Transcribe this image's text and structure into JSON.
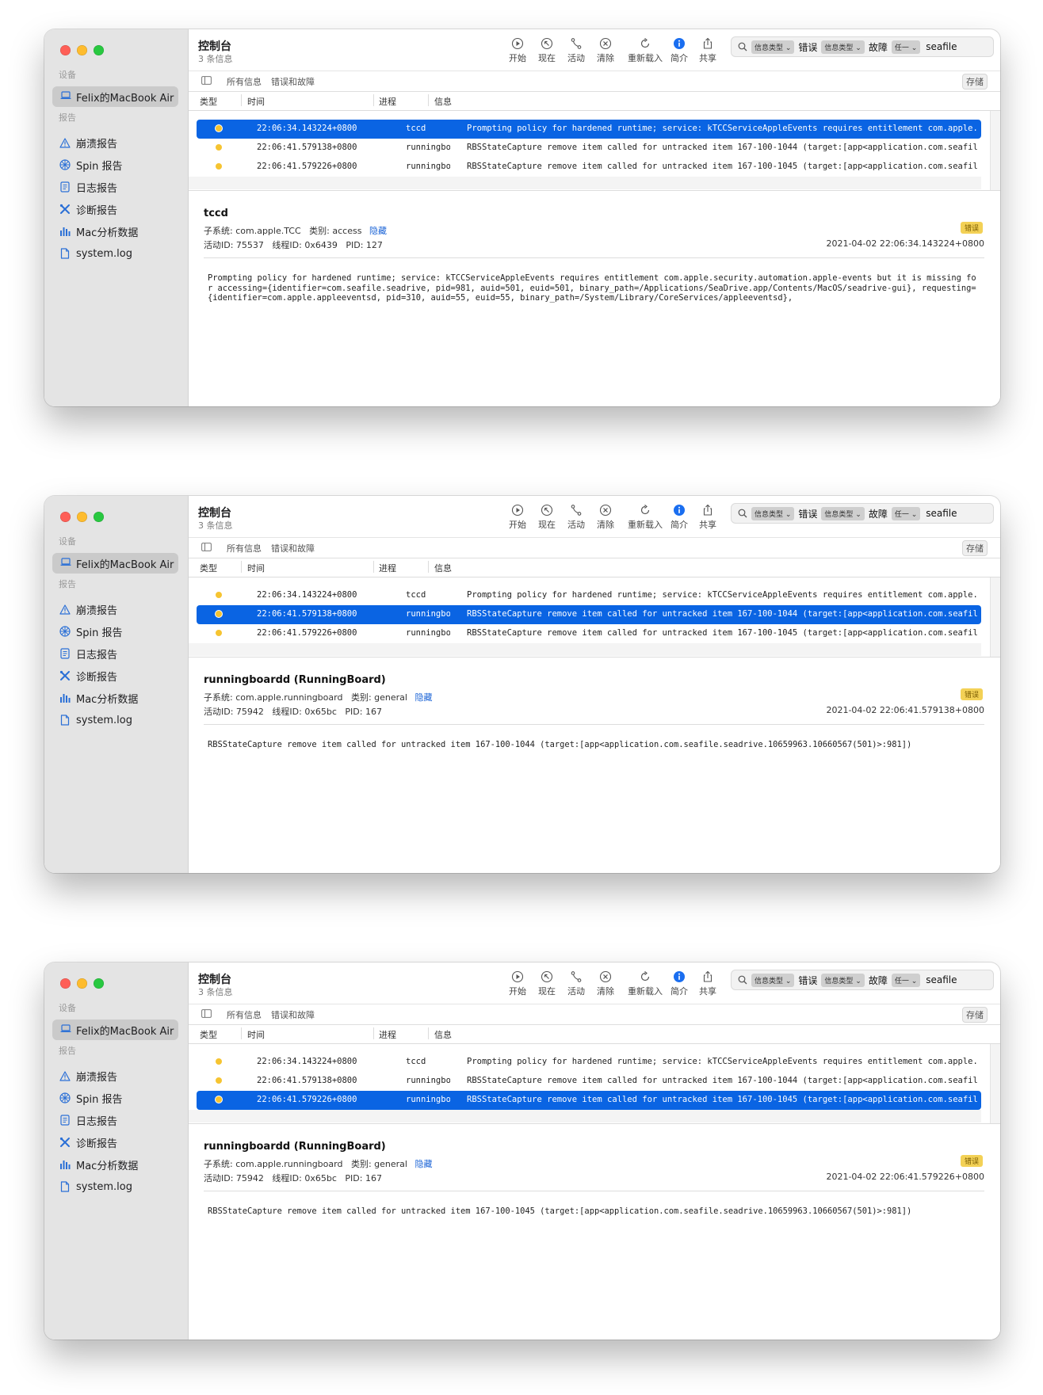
{
  "sidebar": {
    "devices_label": "设备",
    "device_name": "Felix的MacBook Air",
    "reports_label": "报告",
    "items": [
      {
        "label": "崩溃报告",
        "icon": "warning-icon"
      },
      {
        "label": "Spin 报告",
        "icon": "spin-icon"
      },
      {
        "label": "日志报告",
        "icon": "document-icon"
      },
      {
        "label": "诊断报告",
        "icon": "tools-icon"
      },
      {
        "label": "Mac分析数据",
        "icon": "bar-chart-icon"
      },
      {
        "label": "system.log",
        "icon": "file-icon"
      }
    ]
  },
  "toolbar": {
    "title": "控制台",
    "subtitle": "3 条信息",
    "start": "开始",
    "now": "现在",
    "activity": "活动",
    "clear": "清除",
    "reload": "重新载入",
    "info": "简介",
    "share": "共享"
  },
  "search": {
    "token1": "信息类型 ⌄",
    "word1": "错误",
    "token2": "信息类型 ⌄",
    "word2": "故障",
    "token3": "任一 ⌄",
    "value": "seafile"
  },
  "filters": {
    "all": "所有信息",
    "errors": "错误和故障",
    "save": "存储"
  },
  "columns": {
    "type": "类型",
    "time": "时间",
    "process": "进程",
    "message": "信息"
  },
  "rows": [
    {
      "time": "22:06:34.143224+0800",
      "process": "tccd",
      "message": "Prompting policy for hardened runtime; service: kTCCServiceAppleEvents requires entitlement com.apple.security.automation.apple-events"
    },
    {
      "time": "22:06:41.579138+0800",
      "process": "runningboardd",
      "message": "RBSStateCapture remove item called for untracked item 167-100-1044 (target:[app<application.com.seafile.seadrive.10659963.10660567(501)>:981])"
    },
    {
      "time": "22:06:41.579226+0800",
      "process": "runningboardd",
      "message": "RBSStateCapture remove item called for untracked item 167-100-1045 (target:[app<application.com.seafile.seadrive.10659963.10660567(501)>:981])"
    }
  ],
  "labels": {
    "subsystem": "子系统:",
    "category": "类别:",
    "hide": "隐藏",
    "activity_id": "活动ID:",
    "thread_id": "线程ID:",
    "pid": "PID:",
    "badge": "错误"
  },
  "windows": [
    {
      "selected": 0,
      "detail": {
        "title": "tccd",
        "subsystem": "com.apple.TCC",
        "category": "access",
        "activity_id": "75537",
        "thread_id": "0x6439",
        "pid": "127",
        "timestamp": "2021-04-02 22:06:34.143224+0800",
        "message": "Prompting policy for hardened runtime; service: kTCCServiceAppleEvents requires entitlement com.apple.security.automation.apple-events but it is missing for accessing={identifier=com.seafile.seadrive, pid=981, auid=501, euid=501, binary_path=/Applications/SeaDrive.app/Contents/MacOS/seadrive-gui}, requesting={identifier=com.apple.appleeventsd, pid=310, auid=55, euid=55, binary_path=/System/Library/CoreServices/appleeventsd},"
      }
    },
    {
      "selected": 1,
      "detail": {
        "title": "runningboardd (RunningBoard)",
        "subsystem": "com.apple.runningboard",
        "category": "general",
        "activity_id": "75942",
        "thread_id": "0x65bc",
        "pid": "167",
        "timestamp": "2021-04-02 22:06:41.579138+0800",
        "message": "RBSStateCapture remove item called for untracked item 167-100-1044 (target:[app<application.com.seafile.seadrive.10659963.10660567(501)>:981])"
      }
    },
    {
      "selected": 2,
      "detail": {
        "title": "runningboardd (RunningBoard)",
        "subsystem": "com.apple.runningboard",
        "category": "general",
        "activity_id": "75942",
        "thread_id": "0x65bc",
        "pid": "167",
        "timestamp": "2021-04-02 22:06:41.579226+0800",
        "message": "RBSStateCapture remove item called for untracked item 167-100-1045 (target:[app<application.com.seafile.seadrive.10659963.10660567(501)>:981])"
      }
    }
  ]
}
